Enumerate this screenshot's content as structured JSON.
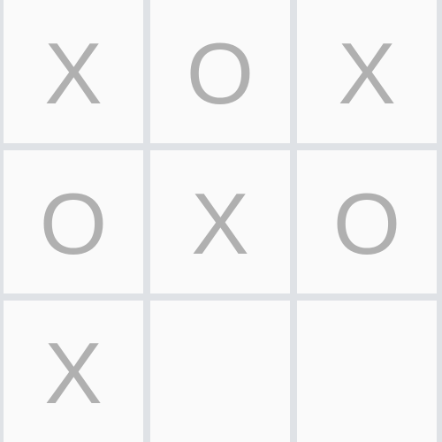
{
  "board": {
    "cells": [
      "X",
      "O",
      "X",
      "O",
      "X",
      "O",
      "X",
      "",
      ""
    ]
  },
  "colors": {
    "background": "#fafafa",
    "gridline": "#dfe2e6",
    "mark": "#b0b0b0"
  }
}
